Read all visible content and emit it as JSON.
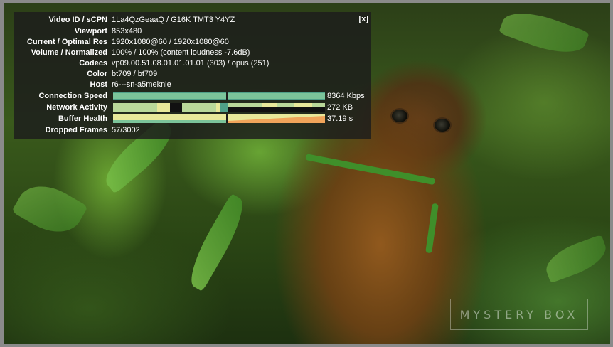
{
  "stats_panel": {
    "close_label": "[x]",
    "rows": [
      {
        "label": "Video ID / sCPN",
        "value": "1La4QzGeaaQ  /  G16K TMT3 Y4YZ"
      },
      {
        "label": "Viewport",
        "value": "853x480"
      },
      {
        "label": "Current / Optimal Res",
        "value": "1920x1080@60 / 1920x1080@60"
      },
      {
        "label": "Volume / Normalized",
        "value": "100% / 100% (content loudness -7.6dB)"
      },
      {
        "label": "Codecs",
        "value": "vp09.00.51.08.01.01.01.01 (303) / opus (251)"
      },
      {
        "label": "Color",
        "value": "bt709 / bt709"
      },
      {
        "label": "Host",
        "value": "r6---sn-a5meknle"
      }
    ],
    "graph_rows": [
      {
        "label": "Connection Speed",
        "value": "8364 Kbps"
      },
      {
        "label": "Network Activity",
        "value": "272 KB"
      },
      {
        "label": "Buffer Health",
        "value": "37.19 s"
      }
    ],
    "dropped": {
      "label": "Dropped Frames",
      "value": "57/3002"
    }
  },
  "watermark": {
    "text": "MYSTERY BOX"
  },
  "colors": {
    "graph_green": "#7bc49a",
    "graph_teal": "#4fa089",
    "graph_yellow": "#e8e89a",
    "graph_orange": "#f0a45a",
    "panel_bg": "rgba(28,28,28,0.82)"
  }
}
